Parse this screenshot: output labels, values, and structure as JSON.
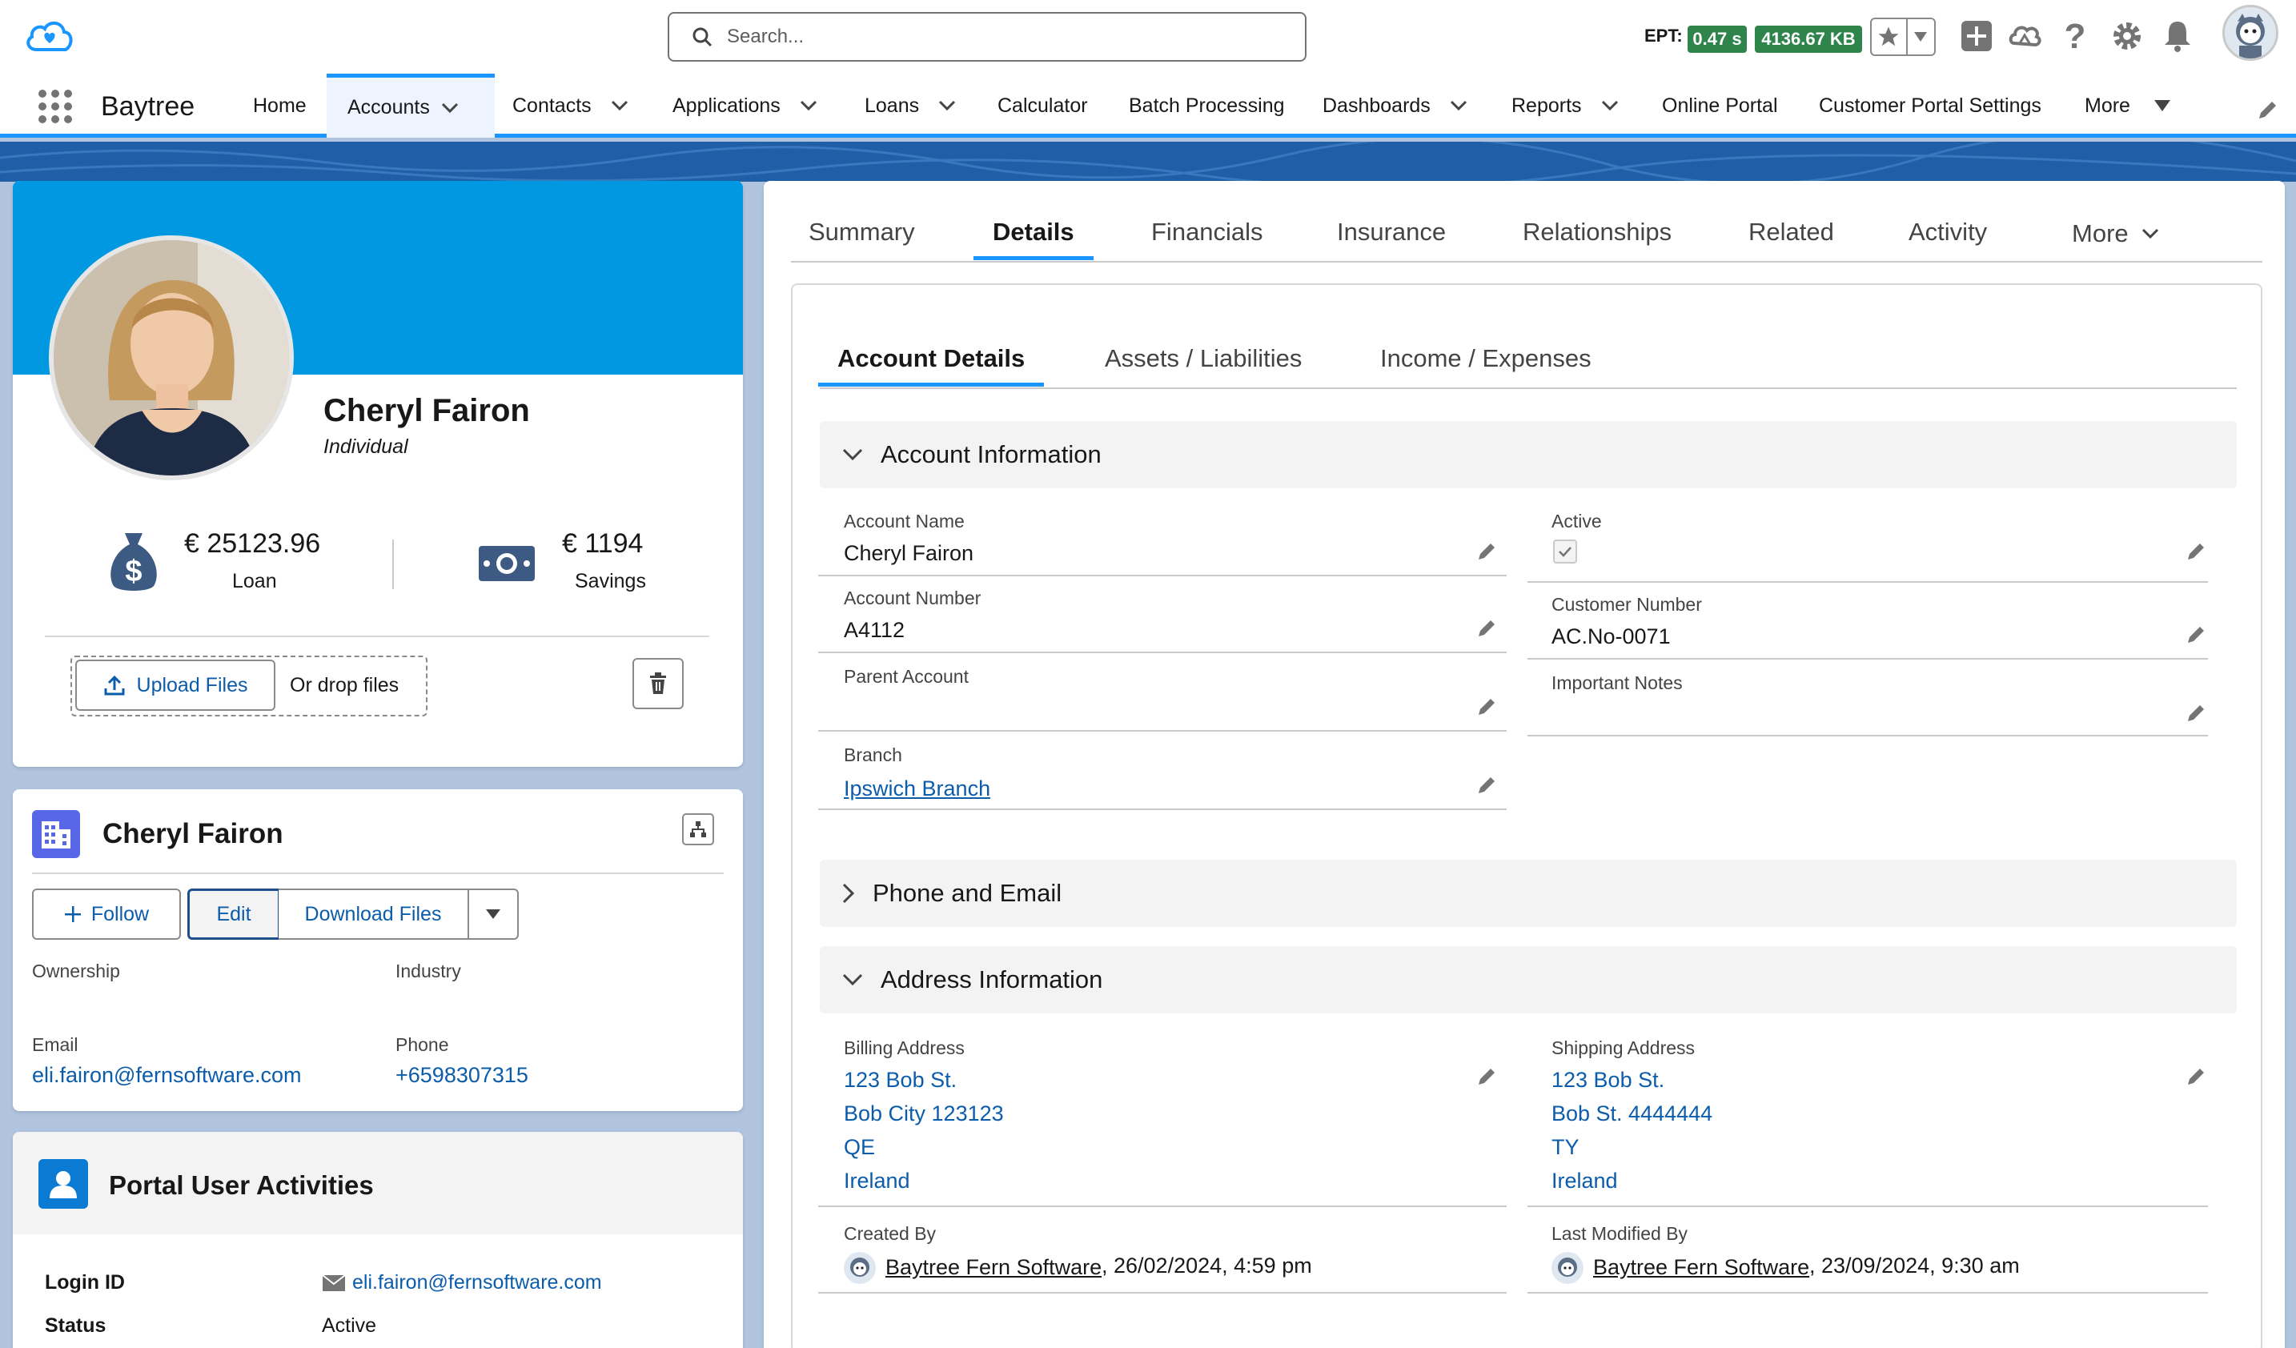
{
  "header": {
    "search_placeholder": "Search...",
    "ept_label": "EPT:",
    "ept_time": "0.47 s",
    "ept_size": "4136.67 KB"
  },
  "nav": {
    "app_name": "Baytree",
    "items": [
      {
        "label": "Home"
      },
      {
        "label": "Accounts"
      },
      {
        "label": "Contacts"
      },
      {
        "label": "Applications"
      },
      {
        "label": "Loans"
      },
      {
        "label": "Calculator"
      },
      {
        "label": "Batch Processing"
      },
      {
        "label": "Dashboards"
      },
      {
        "label": "Reports"
      },
      {
        "label": "Online Portal"
      },
      {
        "label": "Customer Portal Settings"
      },
      {
        "label": "More"
      }
    ]
  },
  "profile": {
    "name": "Cheryl Fairon",
    "type": "Individual",
    "loan_value": "€ 25123.96",
    "loan_label": "Loan",
    "savings_value": "€ 1194",
    "savings_label": "Savings",
    "upload_label": "Upload Files",
    "drop_label": "Or drop files"
  },
  "account_card": {
    "title": "Cheryl Fairon",
    "follow_label": "Follow",
    "edit_label": "Edit",
    "download_label": "Download Files",
    "ownership_label": "Ownership",
    "industry_label": "Industry",
    "email_label": "Email",
    "email_value": "eli.fairon@fernsoftware.com",
    "phone_label": "Phone",
    "phone_value": "+6598307315"
  },
  "portal": {
    "title": "Portal User Activities",
    "login_label": "Login ID",
    "login_value": "eli.fairon@fernsoftware.com",
    "status_label": "Status",
    "status_value": "Active"
  },
  "tabs": [
    "Summary",
    "Details",
    "Financials",
    "Insurance",
    "Relationships",
    "Related",
    "Activity",
    "More"
  ],
  "subtabs": [
    "Account Details",
    "Assets / Liabilities",
    "Income / Expenses"
  ],
  "sections": {
    "account_info": "Account Information",
    "phone_email": "Phone and Email",
    "address_info": "Address Information"
  },
  "fields": {
    "account_name_label": "Account Name",
    "account_name": "Cheryl Fairon",
    "active_label": "Active",
    "account_number_label": "Account Number",
    "account_number": "A4112",
    "customer_number_label": "Customer Number",
    "customer_number": "AC.No-0071",
    "parent_account_label": "Parent Account",
    "important_notes_label": "Important Notes",
    "branch_label": "Branch",
    "branch": "Ipswich Branch",
    "billing_label": "Billing Address",
    "billing": [
      "123 Bob St.",
      "Bob City 123123",
      "QE",
      "Ireland"
    ],
    "shipping_label": "Shipping Address",
    "shipping": [
      "123 Bob St.",
      "Bob St. 4444444",
      "TY",
      "Ireland"
    ],
    "created_label": "Created By",
    "created_by": "Baytree Fern Software",
    "created_date": ", 26/02/2024, 4:59 pm",
    "modified_label": "Last Modified By",
    "modified_by": "Baytree Fern Software",
    "modified_date": ", 23/09/2024, 9:30 am"
  },
  "colors": {
    "brand_blue": "#0099e1",
    "accent": "#1b96ff",
    "ept_green": "#2e844a",
    "link": "#0b5cab"
  }
}
